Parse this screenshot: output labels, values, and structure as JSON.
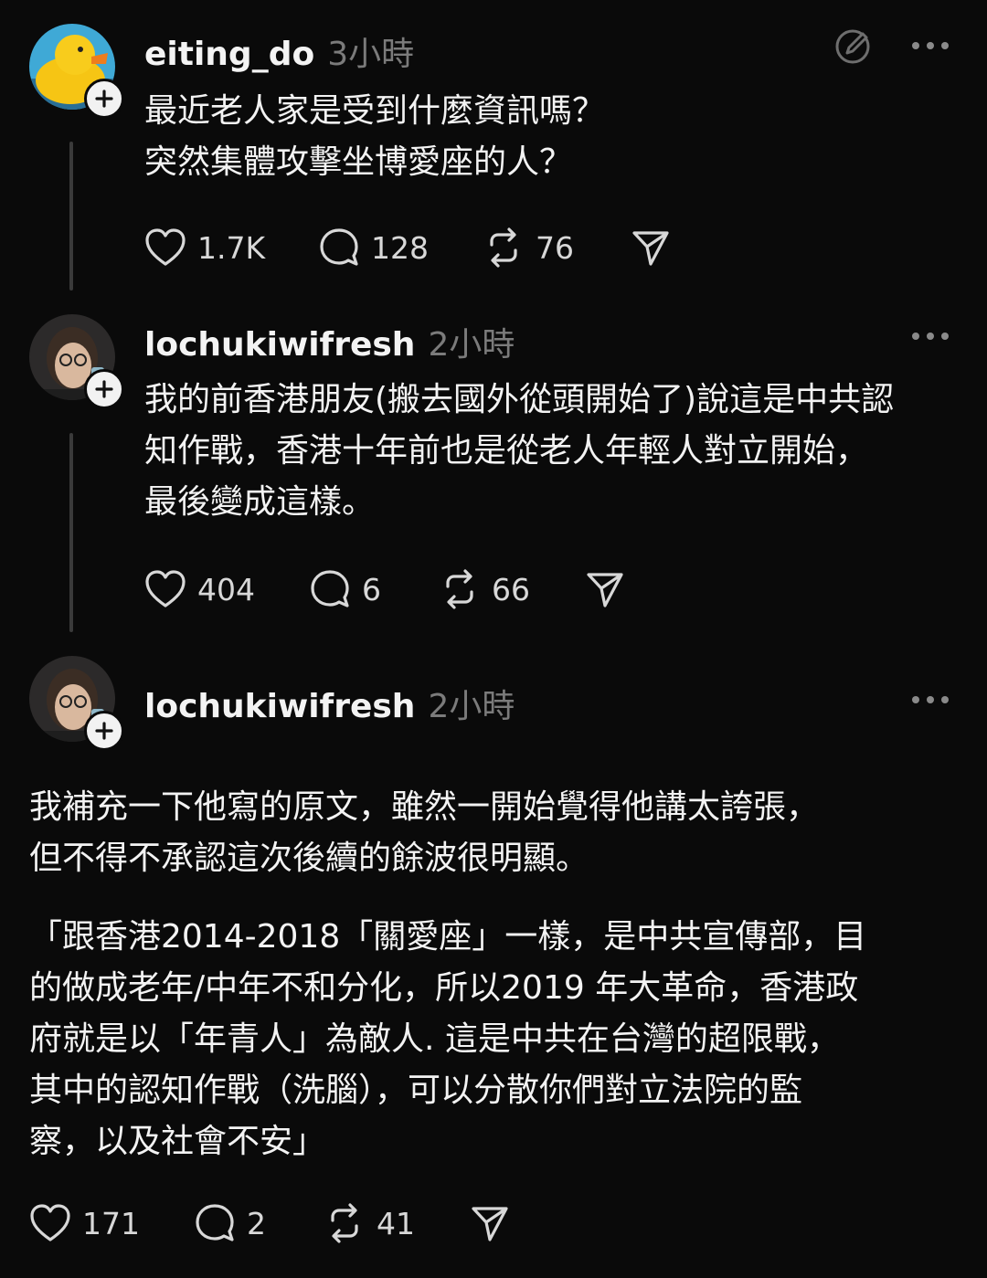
{
  "posts": [
    {
      "username": "eiting_do",
      "time": "3小時",
      "text": "最近老人家是受到什麼資訊嗎？\n突然集體攻擊坐博愛座的人？",
      "likes": "1.7K",
      "comments": "128",
      "reposts": "76"
    },
    {
      "username": "lochukiwifresh",
      "time": "2小時",
      "text": "我的前香港朋友(搬去國外從頭開始了)說這是中共認\n知作戰，香港十年前也是從老人年輕人對立開始，\n最後變成這樣。",
      "likes": "404",
      "comments": "6",
      "reposts": "66"
    },
    {
      "username": "lochukiwifresh",
      "time": "2小時",
      "text_para1": "我補充一下他寫的原文，雖然一開始覺得他講太誇張，\n但不得不承認這次後續的餘波很明顯。",
      "text_para2": "「跟香港2014-2018「關愛座」一樣，是中共宣傳部，目\n的做成老年/中年不和分化，所以2019 年大革命，香港政\n府就是以「年青人」為敵人. 這是中共在台灣的超限戰，\n其中的認知作戰（洗腦），可以分散你們對立法院的監\n察，以及社會不安」",
      "likes": "171",
      "comments": "2",
      "reposts": "41"
    }
  ],
  "icons": {
    "heart": "heart-icon",
    "comment": "comment-icon",
    "repost": "repost-icon",
    "share": "share-icon",
    "more": "more-icon",
    "follow": "plus-icon",
    "edit": "edit-icon"
  },
  "colors": {
    "background": "#0a0a0a",
    "text": "#f3f3f3",
    "muted": "#7b7b7b",
    "thread_line": "#3a3a3a"
  }
}
